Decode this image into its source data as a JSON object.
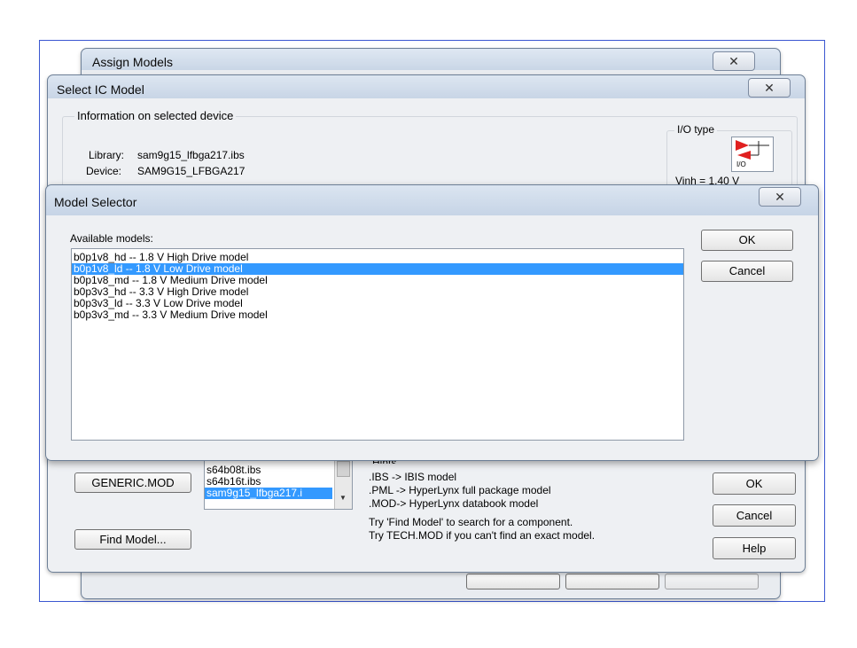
{
  "assign_models": {
    "title": "Assign Models",
    "close_glyph": "✕"
  },
  "select_ic": {
    "title": "Select IC Model",
    "close_glyph": "✕",
    "info_group_label": "Information on selected device",
    "library_label": "Library:",
    "library_value": "sam9g15_lfbga217.ibs",
    "device_label": "Device:",
    "device_value": "SAM9G15_LFBGA217",
    "io_type_label": "I/O type",
    "io_icon_text": "I/O",
    "vinh_text": "Vinh = 1.40 V",
    "generic_button": "GENERIC.MOD",
    "find_model_button": "Find Model...",
    "files": [
      "s64b08t.ibs",
      "s64b16t.ibs",
      "sam9g15_lfbga217.i"
    ],
    "hints": {
      "label": "Hints",
      "lines": [
        ".IBS   -> IBIS model",
        ".PML -> HyperLynx full package model",
        ".MOD-> HyperLynx databook model",
        "Try 'Find Model' to search for a component.",
        "Try TECH.MOD if you can't find an exact model."
      ]
    },
    "ok_button": "OK",
    "cancel_button": "Cancel",
    "help_button": "Help"
  },
  "model_selector": {
    "title": "Model Selector",
    "close_glyph": "✕",
    "available_label": "Available models:",
    "models": [
      "b0p1v8_hd -- 1.8 V High Drive model",
      "b0p1v8_ld -- 1.8 V Low Drive model",
      "b0p1v8_md -- 1.8 V Medium Drive model",
      "b0p3v3_hd -- 3.3 V High Drive model",
      "b0p3v3_ld -- 3.3 V Low Drive model",
      "b0p3v3_md -- 3.3 V Medium Drive model"
    ],
    "selected_index": 1,
    "ok_button": "OK",
    "cancel_button": "Cancel"
  },
  "colors": {
    "selection": "#3399ff",
    "frame_border": "#3b57d1",
    "io_arrow": "#e02020"
  }
}
